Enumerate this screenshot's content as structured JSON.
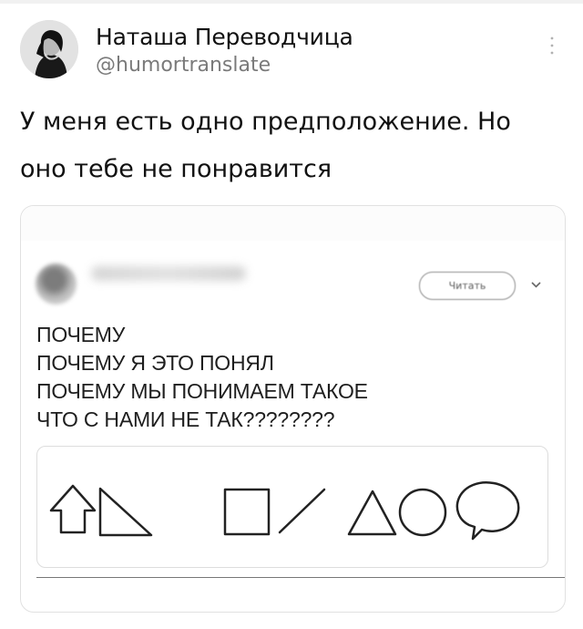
{
  "author": {
    "name": "Наташа Переводчица",
    "handle": "@humortranslate"
  },
  "tweet": {
    "text": "У меня есть одно предположение. Но оно тебе не понравится"
  },
  "embedded": {
    "read_button_label": "Читать",
    "meme_lines": [
      "ПОЧЕМУ",
      "ПОЧЕМУ Я ЭТО ПОНЯЛ",
      "ПОЧЕМУ МЫ ПОНИМАЕМ ТАКОЕ",
      "ЧТО С НАМИ НЕ ТАК????????"
    ]
  },
  "icons": {
    "more": "vertical-dots-icon",
    "chevron": "chevron-down-icon"
  }
}
